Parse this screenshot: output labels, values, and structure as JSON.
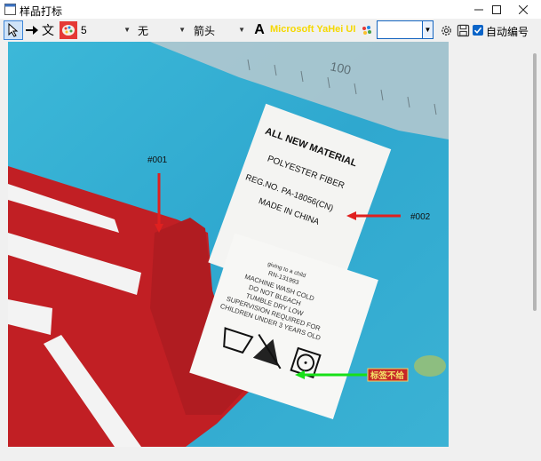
{
  "window": {
    "title": "样品打标"
  },
  "toolbar": {
    "text_tool_label": "文",
    "size_value": "5",
    "line_style_value": "无",
    "shape_value": "箭头",
    "font_icon_label": "A",
    "font_name": "Microsoft YaHei UI",
    "auto_number_label": "自动编号",
    "auto_number_checked": true
  },
  "annotations": {
    "label_001": "#001",
    "label_002": "#002",
    "note_text": "标签不给"
  },
  "photo_text": {
    "tag_line1": "ALL NEW MATERIAL",
    "tag_line2": "POLYESTER FIBER",
    "tag_line3": "REG.NO. PA-18056(CN)",
    "tag_line4": "MADE IN CHINA",
    "care_line1": "giving to a child",
    "care_line2": "RN-131993",
    "care_line3": "MACHINE WASH COLD",
    "care_line4": "DO NOT BLEACH",
    "care_line5": "TUMBLE DRY LOW",
    "care_line6": "SUPERVISION REQUIRED FOR",
    "care_line7": "CHILDREN UNDER 3 YEARS OLD",
    "ruler_number": "100"
  },
  "colors": {
    "accent_blue": "#1565c0",
    "arrow_red": "#e0201f",
    "arrow_green": "#18e018",
    "note_bg": "#c62828",
    "font_name_color": "#f5d800"
  }
}
